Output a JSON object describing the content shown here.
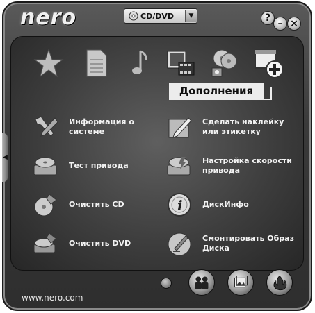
{
  "app": {
    "logo": "nero",
    "url": "www.nero.com"
  },
  "project_select": {
    "value": "CD/DVD"
  },
  "window_buttons": {
    "help": "?",
    "minimize": "–",
    "close": "×"
  },
  "categories": [
    {
      "icon": "star-icon"
    },
    {
      "icon": "document-icon"
    },
    {
      "icon": "music-note-icon"
    },
    {
      "icon": "film-photo-icon"
    },
    {
      "icon": "disc-copy-icon"
    },
    {
      "icon": "add-window-icon",
      "selected": true
    }
  ],
  "active_category": "Дополнения",
  "tools_left": [
    {
      "label": "Информация о системе",
      "icon": "wrench-icon"
    },
    {
      "label": "Тест привода",
      "icon": "drive-test-icon"
    },
    {
      "label": "Очистить CD",
      "icon": "erase-cd-icon"
    },
    {
      "label": "Очистить DVD",
      "icon": "erase-dvd-icon"
    }
  ],
  "tools_right": [
    {
      "label": "Сделать наклейку или этикетку",
      "icon": "label-pen-icon"
    },
    {
      "label": "Настройка скорости привода",
      "icon": "drive-speed-icon"
    },
    {
      "label": "ДискИнфо",
      "icon": "disc-info-icon"
    },
    {
      "label": "Смонтировать Образ Диска",
      "icon": "mount-image-icon"
    }
  ]
}
